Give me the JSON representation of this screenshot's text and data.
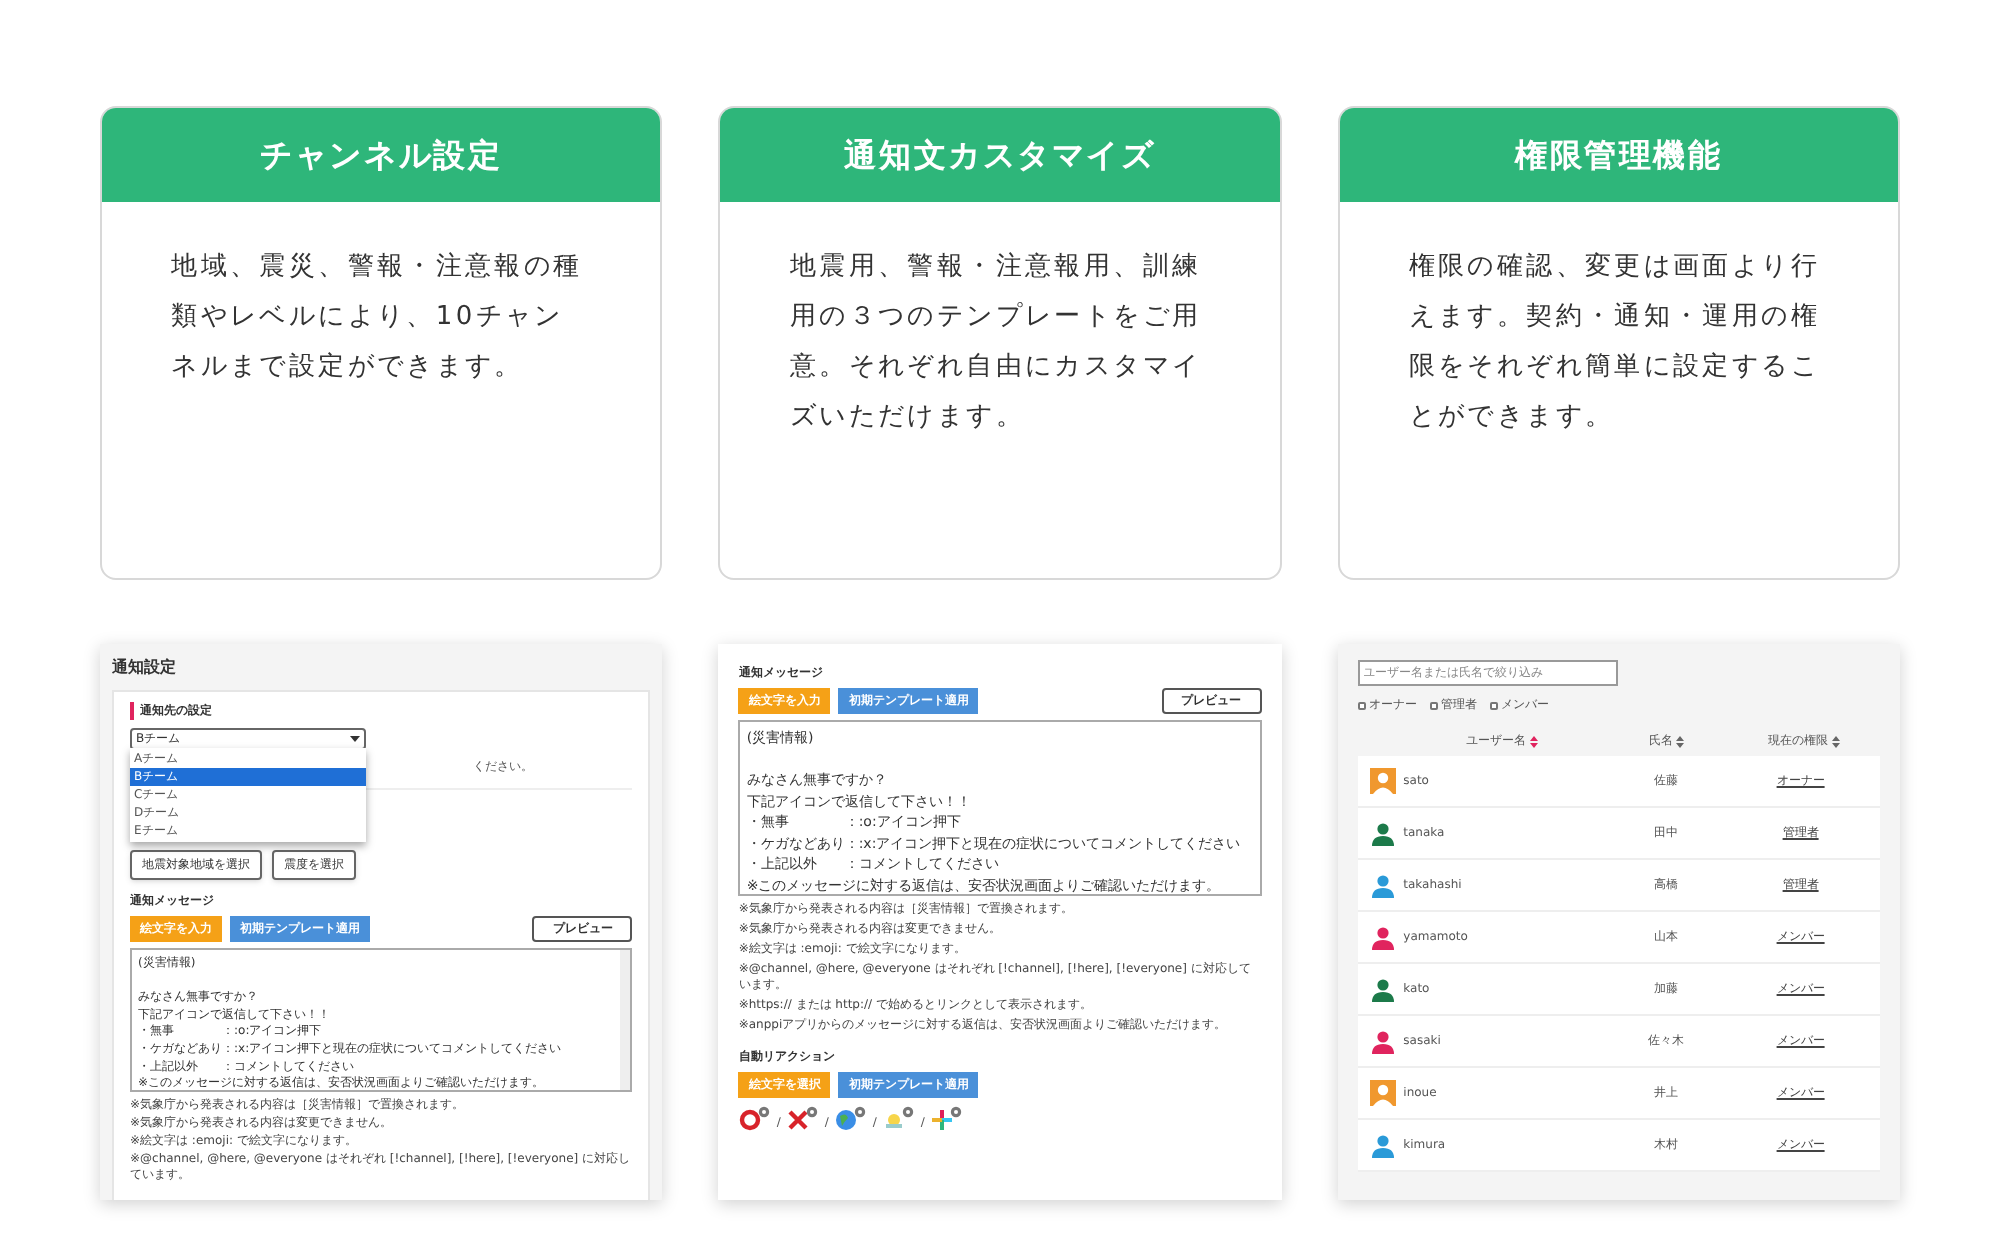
{
  "features": [
    {
      "title": "チャンネル設定",
      "description": "地域、震災、警報・注意報の種類やレベルにより、10チャンネルまで設定ができます。"
    },
    {
      "title": "通知文カスタマイズ",
      "description": "地震用、警報・注意報用、訓練用の３つのテンプレートをご用意。それぞれ自由にカスタマイズいただけます。"
    },
    {
      "title": "権限管理機能",
      "description": "権限の確認、変更は画面より行えます。契約・通知・運用の権限をそれぞれ簡単に設定することができます。"
    }
  ],
  "screenshots": [
    {
      "kind": "settings",
      "title": "通知設定",
      "section": "通知先の設定",
      "select_value": "Bチーム",
      "options": [
        {
          "label": "Aチーム",
          "selected": false
        },
        {
          "label": "Bチーム",
          "selected": true
        },
        {
          "label": "Cチーム",
          "selected": false
        },
        {
          "label": "Dチーム",
          "selected": false
        },
        {
          "label": "Eチーム",
          "selected": false
        }
      ],
      "hidden_text": "ください。",
      "area_buttons": [
        "地震対象地域を選択",
        "震度を選択"
      ],
      "message_label": "通知メッセージ",
      "emoji_button": "絵文字を入力",
      "template_button": "初期テンプレート適用",
      "preview_button": "プレビュー",
      "message_lines": [
        "(災害情報)",
        "みなさん無事ですか？",
        "下記アイコンで返信して下さい！！",
        "・無事　　　　：:o:アイコン押下",
        "・ケガなどあり：:x:アイコン押下と現在の症状についてコメントしてください",
        "・上記以外　　：コメントしてください",
        "※このメッセージに対する返信は、安否状況画面よりご確認いただけます。"
      ],
      "notes": [
        "※気象庁から発表される内容は［災害情報］で置換されます。",
        "※気象庁から発表される内容は変更できません。",
        "※絵文字は :emoji: で絵文字になります。",
        "※@channel, @here, @everyone はそれぞれ [!channel], [!here], [!everyone] に対応しています。"
      ]
    },
    {
      "kind": "message",
      "message_label": "通知メッセージ",
      "emoji_button": "絵文字を入力",
      "template_button": "初期テンプレート適用",
      "preview_button": "プレビュー",
      "message_lines": [
        "(災害情報)",
        "みなさん無事ですか？",
        "下記アイコンで返信して下さい！！",
        "・無事　　　　：:o:アイコン押下",
        "・ケガなどあり：:x:アイコン押下と現在の症状についてコメントしてください",
        "・上記以外　　：コメントしてください",
        "※このメッセージに対する返信は、安否状況画面よりご確認いただけます。"
      ],
      "notes": [
        "※気象庁から発表される内容は［災害情報］で置換されます。",
        "※気象庁から発表される内容は変更できません。",
        "※絵文字は :emoji: で絵文字になります。",
        "※@channel, @here, @everyone はそれぞれ [!channel], [!here], [!everyone] に対応しています。",
        "※https:// または http:// で始めるとリンクとして表示されます。",
        "※anppiアプリからのメッセージに対する返信は、安否状況画面よりご確認いただけます。"
      ],
      "reaction_label": "自動リアクション",
      "reaction_emoji_button": "絵文字を選択",
      "reaction_template_button": "初期テンプレート適用",
      "reactions": [
        {
          "kind": "circle"
        },
        {
          "kind": "cross"
        },
        {
          "kind": "globe"
        },
        {
          "kind": "sun"
        },
        {
          "kind": "pinwheel"
        }
      ],
      "separator": "/"
    },
    {
      "kind": "members",
      "search_placeholder": "ユーザー名または氏名で絞り込み",
      "filters": [
        {
          "label": "オーナー",
          "checked": false
        },
        {
          "label": "管理者",
          "checked": false
        },
        {
          "label": "メンバー",
          "checked": false
        }
      ],
      "columns": [
        {
          "label": "ユーザー名",
          "active": true
        },
        {
          "label": "氏名",
          "active": false
        },
        {
          "label": "現在の権限",
          "active": false
        }
      ],
      "rows": [
        {
          "username": "sato",
          "name": "佐藤",
          "role": "オーナー",
          "color": "#f0982e",
          "kind": "tile"
        },
        {
          "username": "tanaka",
          "name": "田中",
          "role": "管理者",
          "color": "#1c7a4a",
          "kind": "figure"
        },
        {
          "username": "takahashi",
          "name": "高橋",
          "role": "管理者",
          "color": "#2a9ad8",
          "kind": "figure"
        },
        {
          "username": "yamamoto",
          "name": "山本",
          "role": "メンバー",
          "color": "#e0245e",
          "kind": "figure"
        },
        {
          "username": "kato",
          "name": "加藤",
          "role": "メンバー",
          "color": "#1c7a4a",
          "kind": "figure"
        },
        {
          "username": "sasaki",
          "name": "佐々木",
          "role": "メンバー",
          "color": "#e0245e",
          "kind": "figure"
        },
        {
          "username": "inoue",
          "name": "井上",
          "role": "メンバー",
          "color": "#f0982e",
          "kind": "tile"
        },
        {
          "username": "kimura",
          "name": "木村",
          "role": "メンバー",
          "color": "#2a9ad8",
          "kind": "figure"
        }
      ]
    }
  ]
}
